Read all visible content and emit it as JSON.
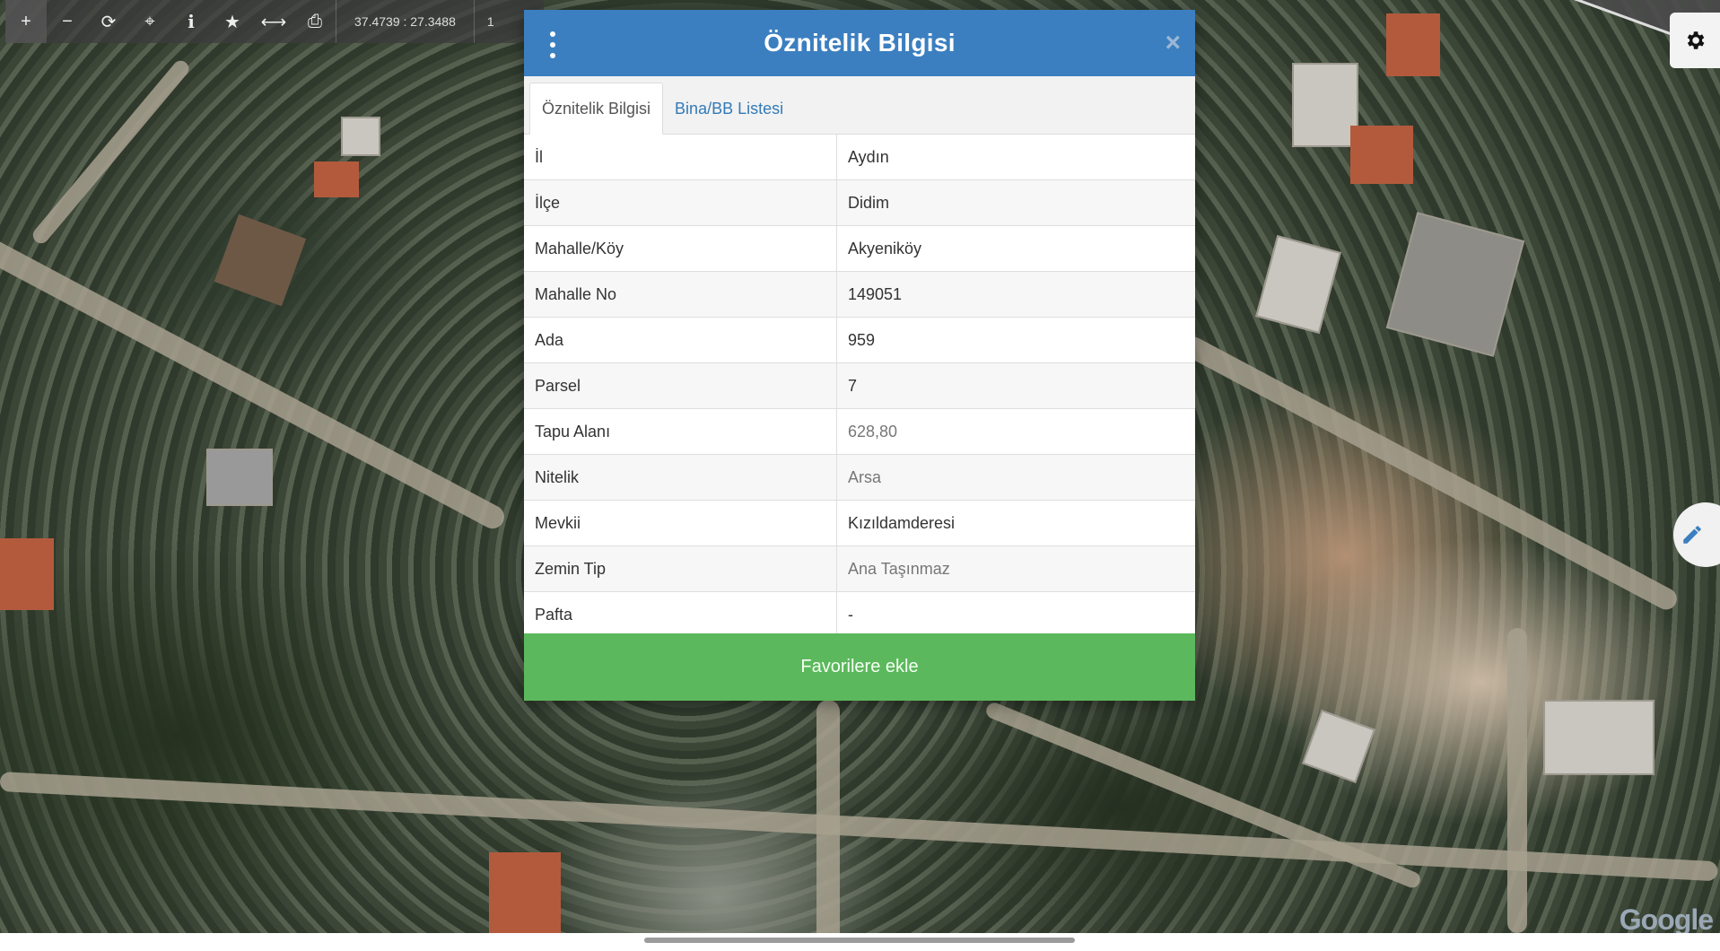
{
  "toolbar": {
    "tools": [
      {
        "name": "zoom-in-icon",
        "glyph": "+"
      },
      {
        "name": "zoom-out-icon",
        "glyph": "−"
      },
      {
        "name": "refresh-icon",
        "glyph": "⟳"
      },
      {
        "name": "locate-icon",
        "glyph": "⌖"
      },
      {
        "name": "info-icon",
        "glyph": "i"
      },
      {
        "name": "star-icon",
        "glyph": "★"
      },
      {
        "name": "measure-icon",
        "glyph": "⟷"
      },
      {
        "name": "print-icon",
        "glyph": "⎙"
      }
    ],
    "coordinates": "37.4739 : 27.3488",
    "scale_prefix": "1"
  },
  "modal": {
    "title": "Öznitelik Bilgisi",
    "close_glyph": "×",
    "tabs": [
      {
        "label": "Öznitelik Bilgisi",
        "active": true
      },
      {
        "label": "Bina/BB Listesi",
        "active": false
      }
    ],
    "rows": [
      {
        "key": "İl",
        "value": "Aydın"
      },
      {
        "key": "İlçe",
        "value": "Didim"
      },
      {
        "key": "Mahalle/Köy",
        "value": "Akyeniköy"
      },
      {
        "key": "Mahalle No",
        "value": "149051"
      },
      {
        "key": "Ada",
        "value": "959"
      },
      {
        "key": "Parsel",
        "value": "7"
      },
      {
        "key": "Tapu Alanı",
        "value": "628,80"
      },
      {
        "key": "Nitelik",
        "value": "Arsa"
      },
      {
        "key": "Mevkii",
        "value": "Kızıldamderesi"
      },
      {
        "key": "Zemin Tip",
        "value": "Ana Taşınmaz"
      },
      {
        "key": "Pafta",
        "value": "-"
      }
    ],
    "favorite_button": "Favorilere ekle"
  },
  "map": {
    "attribution": "Google"
  },
  "colors": {
    "header_blue": "#3b7fc0",
    "favorite_green": "#5cb85c",
    "tab_link_blue": "#337ab7"
  }
}
